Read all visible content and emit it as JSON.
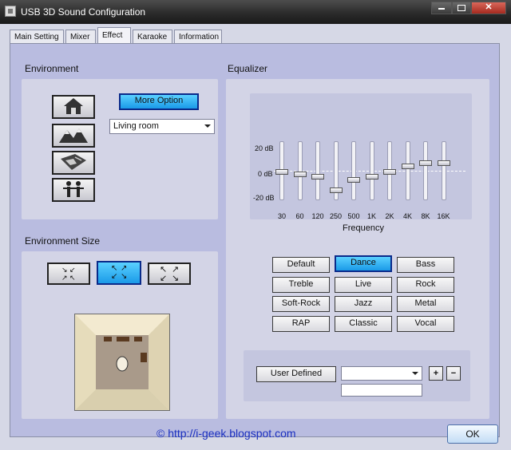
{
  "window": {
    "title": "USB 3D Sound Configuration"
  },
  "tabs": [
    {
      "label": "Main Setting"
    },
    {
      "label": "Mixer"
    },
    {
      "label": "Effect"
    },
    {
      "label": "Karaoke"
    },
    {
      "label": "Information"
    }
  ],
  "active_tab": "Effect",
  "environment": {
    "heading": "Environment",
    "more_option_label": "More Option",
    "selected_environment": "Living room",
    "icons": [
      "house-icon",
      "mountains-icon",
      "map-icon",
      "people-icon"
    ]
  },
  "environment_size": {
    "heading": "Environment Size",
    "sizes": [
      "small-room-icon",
      "medium-room-icon",
      "large-room-icon"
    ],
    "selected_size_index": 1
  },
  "equalizer": {
    "heading": "Equalizer",
    "db_labels": [
      "20 dB",
      "0 dB",
      "-20 dB"
    ],
    "frequency_label": "Frequency",
    "bands": [
      "30",
      "60",
      "120",
      "250",
      "500",
      "1K",
      "2K",
      "4K",
      "8K",
      "16K"
    ],
    "levels_db": [
      0,
      -2,
      -4,
      -14,
      -6,
      -4,
      0,
      4,
      6,
      6
    ],
    "presets": [
      "Default",
      "Dance",
      "Bass",
      "Treble",
      "Live",
      "Rock",
      "Soft-Rock",
      "Jazz",
      "Metal",
      "RAP",
      "Classic",
      "Vocal"
    ],
    "selected_preset": "Dance",
    "user_defined_label": "User  Defined",
    "user_preset_value": "",
    "user_name_value": "",
    "add_label": "+",
    "remove_label": "−"
  },
  "footer": {
    "link_text": "© http://i-geek.blogspot.com",
    "ok_label": "OK"
  },
  "colors": {
    "accent": "#1a9ae8",
    "panel": "#b9bce0",
    "group": "#d3d4e6",
    "titlebar": "#2b2b2b"
  }
}
